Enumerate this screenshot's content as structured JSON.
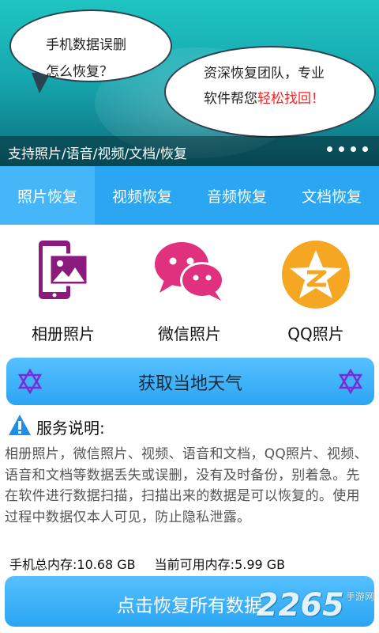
{
  "banner": {
    "bubble1_line1": "手机数据误删",
    "bubble1_line2": "怎么恢复？",
    "bubble2_line1": "资深恢复团队，专业",
    "bubble2_line2_a": "软件帮您",
    "bubble2_line2_b": "轻松找回！",
    "caption": "支持照片/语音/视频/文档/恢复",
    "dot_count": 4
  },
  "tabs": [
    {
      "label": "照片恢复",
      "active": true
    },
    {
      "label": "视频恢复",
      "active": false
    },
    {
      "label": "音频恢复",
      "active": false
    },
    {
      "label": "文档恢复",
      "active": false
    }
  ],
  "cards": [
    {
      "label": "相册照片",
      "icon": "album-photo-icon",
      "color": "#8a1b7d"
    },
    {
      "label": "微信照片",
      "icon": "wechat-icon",
      "color": "#e0317f"
    },
    {
      "label": "QQ照片",
      "icon": "qq-zone-star-icon",
      "color": "#f5a623"
    }
  ],
  "weather_button": {
    "label": "获取当地天气",
    "icon": "star-of-david-icon"
  },
  "service": {
    "title": "服务说明:",
    "icon": "warning-icon",
    "body": "相册照片，微信照片、视频、语音和文档，QQ照片、视频、语音和文档等数据丢失或误删，没有及时备份，别着急。先在软件进行数据扫描，扫描出来的数据是可以恢复的。使用过程中数据仅本人可见，防止隐私泄露。"
  },
  "memory": {
    "total": "手机总内存:10.68 GB",
    "available": "当前可用内存:5.99 GB"
  },
  "restore_button": {
    "label": "点击恢复所有数据"
  },
  "watermark": {
    "number": "2265",
    "suffix": "手游网"
  },
  "colors": {
    "tab_bar": "#2aa6f2",
    "tab_active": "#45b7f9",
    "button": "#3bb2f8",
    "highlight": "#ff2020"
  }
}
